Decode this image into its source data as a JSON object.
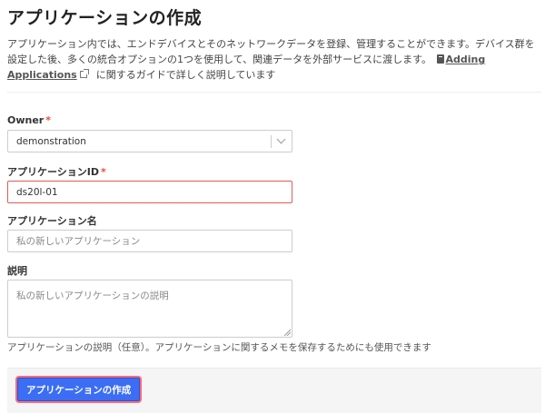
{
  "page": {
    "title": "アプリケーションの作成",
    "description_part1": "アプリケーション内では、エンドデバイスとそのネットワークデータを登録、管理することができます。デバイス群を設定した後、多くの統合オプションの1つを使用して、関連データを外部サービスに渡します。",
    "doc_link": "Adding Applications",
    "description_part2": "に関するガイドで詳しく説明しています"
  },
  "form": {
    "owner": {
      "label": "Owner",
      "required_mark": "*",
      "value": "demonstration"
    },
    "application_id": {
      "label": "アプリケーションID",
      "required_mark": "*",
      "value": "ds20l-01"
    },
    "application_name": {
      "label": "アプリケーション名",
      "placeholder": "私の新しいアプリケーション"
    },
    "description": {
      "label": "説明",
      "placeholder": "私の新しいアプリケーションの説明",
      "help": "アプリケーションの説明（任意）。アプリケーションに関するメモを保存するためにも使用できます"
    }
  },
  "footer": {
    "create_label": "アプリケーションの作成"
  },
  "colors": {
    "accent": "#3b6ef5",
    "required": "#e74c3c",
    "error_border": "#e05a5a"
  }
}
